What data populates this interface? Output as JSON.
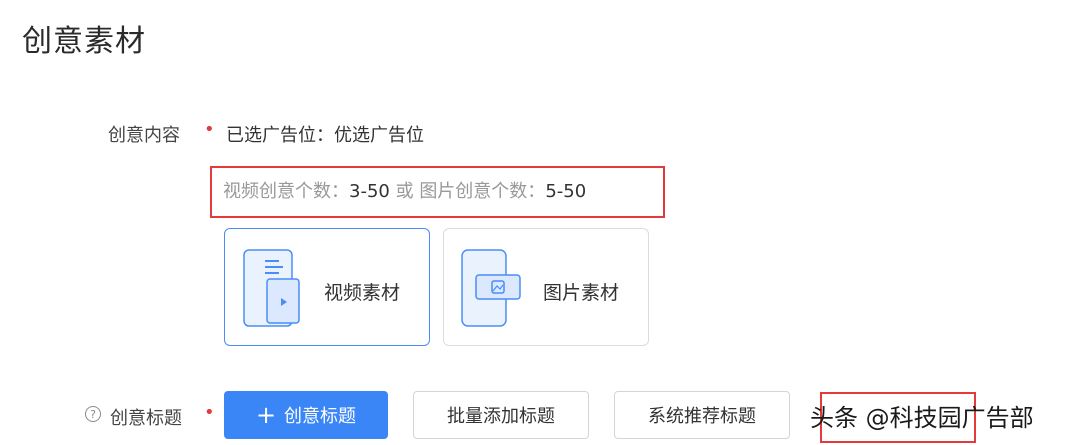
{
  "section": {
    "title": "创意素材"
  },
  "creative_content": {
    "label": "创意内容",
    "required_mark": "•",
    "value": "已选广告位：优选广告位",
    "hint_video_label": "视频创意个数：",
    "hint_video_range": "3-50",
    "hint_or": " 或 ",
    "hint_image_label": "图片创意个数：",
    "hint_image_range": "5-50"
  },
  "material_cards": [
    {
      "label": "视频素材",
      "icon": "video-material-icon",
      "selected": true
    },
    {
      "label": "图片素材",
      "icon": "image-material-icon",
      "selected": false
    }
  ],
  "creative_title": {
    "label": "创意标题",
    "required_mark": "•",
    "help_icon": "?",
    "add_button_icon": "+",
    "add_button_label": "创意标题",
    "batch_button_label": "批量添加标题",
    "recommend_button_label": "系统推荐标题"
  },
  "watermark": {
    "text": "头条 @科技园广告部"
  },
  "colors": {
    "primary": "#3b86f7",
    "required": "#e23b3b",
    "annotation": "#e33b3b",
    "selected_border": "#4a8df6"
  }
}
